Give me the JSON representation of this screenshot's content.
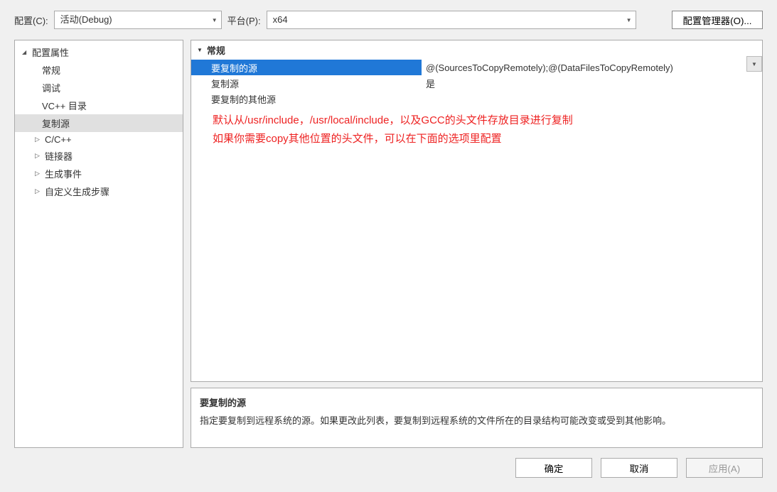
{
  "topbar": {
    "config_label": "配置(C):",
    "config_value": "活动(Debug)",
    "platform_label": "平台(P):",
    "platform_value": "x64",
    "config_manager": "配置管理器(O)..."
  },
  "tree": {
    "root": "配置属性",
    "items": [
      {
        "label": "常规",
        "expandable": false
      },
      {
        "label": "调试",
        "expandable": false
      },
      {
        "label": "VC++ 目录",
        "expandable": false
      },
      {
        "label": "复制源",
        "expandable": false,
        "selected": true
      },
      {
        "label": "C/C++",
        "expandable": true
      },
      {
        "label": "链接器",
        "expandable": true
      },
      {
        "label": "生成事件",
        "expandable": true
      },
      {
        "label": "自定义生成步骤",
        "expandable": true
      }
    ]
  },
  "propgrid": {
    "header": "常规",
    "rows": [
      {
        "name": "要复制的源",
        "value": "@(SourcesToCopyRemotely);@(DataFilesToCopyRemotely)",
        "selected": true
      },
      {
        "name": "复制源",
        "value": "是"
      },
      {
        "name": "要复制的其他源",
        "value": ""
      }
    ]
  },
  "annotation": {
    "line1": "默认从/usr/include，/usr/local/include，以及GCC的头文件存放目录进行复制",
    "line2": "如果你需要copy其他位置的头文件，可以在下面的选项里配置"
  },
  "description": {
    "title": "要复制的源",
    "text": "指定要复制到远程系统的源。如果更改此列表，要复制到远程系统的文件所在的目录结构可能改变或受到其他影响。"
  },
  "buttons": {
    "ok": "确定",
    "cancel": "取消",
    "apply": "应用(A)"
  }
}
